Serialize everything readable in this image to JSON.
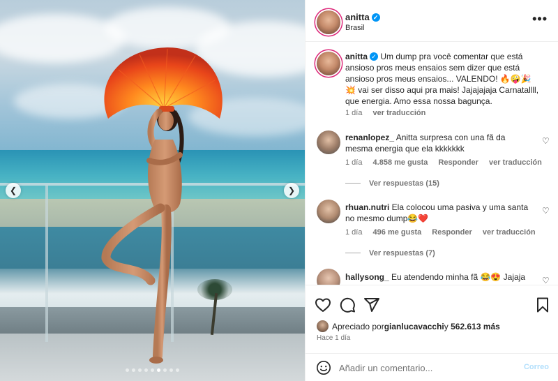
{
  "header": {
    "username": "anitta",
    "location": "Brasil",
    "more_label": "•••"
  },
  "caption": {
    "username": "anitta",
    "text": "Um dump pra você comentar que está ansioso pros meus ensaios sem dizer que está ansioso pros meus ensaios... VALENDO! 🔥🤪🎉💥 vai ser disso aqui pra mais! Jajajajaja Carnatallll, que energia. Amo essa nossa bagunça.",
    "time": "1 día",
    "translate": "ver traducción"
  },
  "comments": [
    {
      "username": "renanlopez_",
      "text": "Anitta surpresa con una fã da mesma energia que ela kkkkkkk",
      "time": "1 día",
      "likes": "4.858 me gusta",
      "reply": "Responder",
      "translate": "ver traducción",
      "replies": "Ver respuestas (15)"
    },
    {
      "username": "rhuan.nutri",
      "text": "Ela colocou uma pasiva y uma santa no mesmo dump😂❤️",
      "time": "1 día",
      "likes": "496 me gusta",
      "reply": "Responder",
      "translate": "ver traducción",
      "replies": "Ver respuestas (7)"
    },
    {
      "username": "hallysong_",
      "text": "Eu atendendo minha fã 😂😍 Jajaja"
    }
  ],
  "likes": {
    "prefix": "Apreciado por",
    "user": "gianlucavacchi",
    "middle": "y",
    "count": "562.613 más"
  },
  "post_time": "Hace 1 día",
  "composer": {
    "placeholder": "Añadir un comentario...",
    "post_label": "Correo"
  },
  "carousel": {
    "total": 9,
    "active_index": 5
  },
  "icons": {
    "like": "heart-icon",
    "comment": "comment-icon",
    "share": "paper-plane-icon",
    "save": "bookmark-icon",
    "emoji": "smiley-icon",
    "verified": "verified-badge-icon"
  },
  "colors": {
    "verified": "#0095f6",
    "post_disabled": "#b2dffc",
    "secondary_text": "#737373"
  }
}
